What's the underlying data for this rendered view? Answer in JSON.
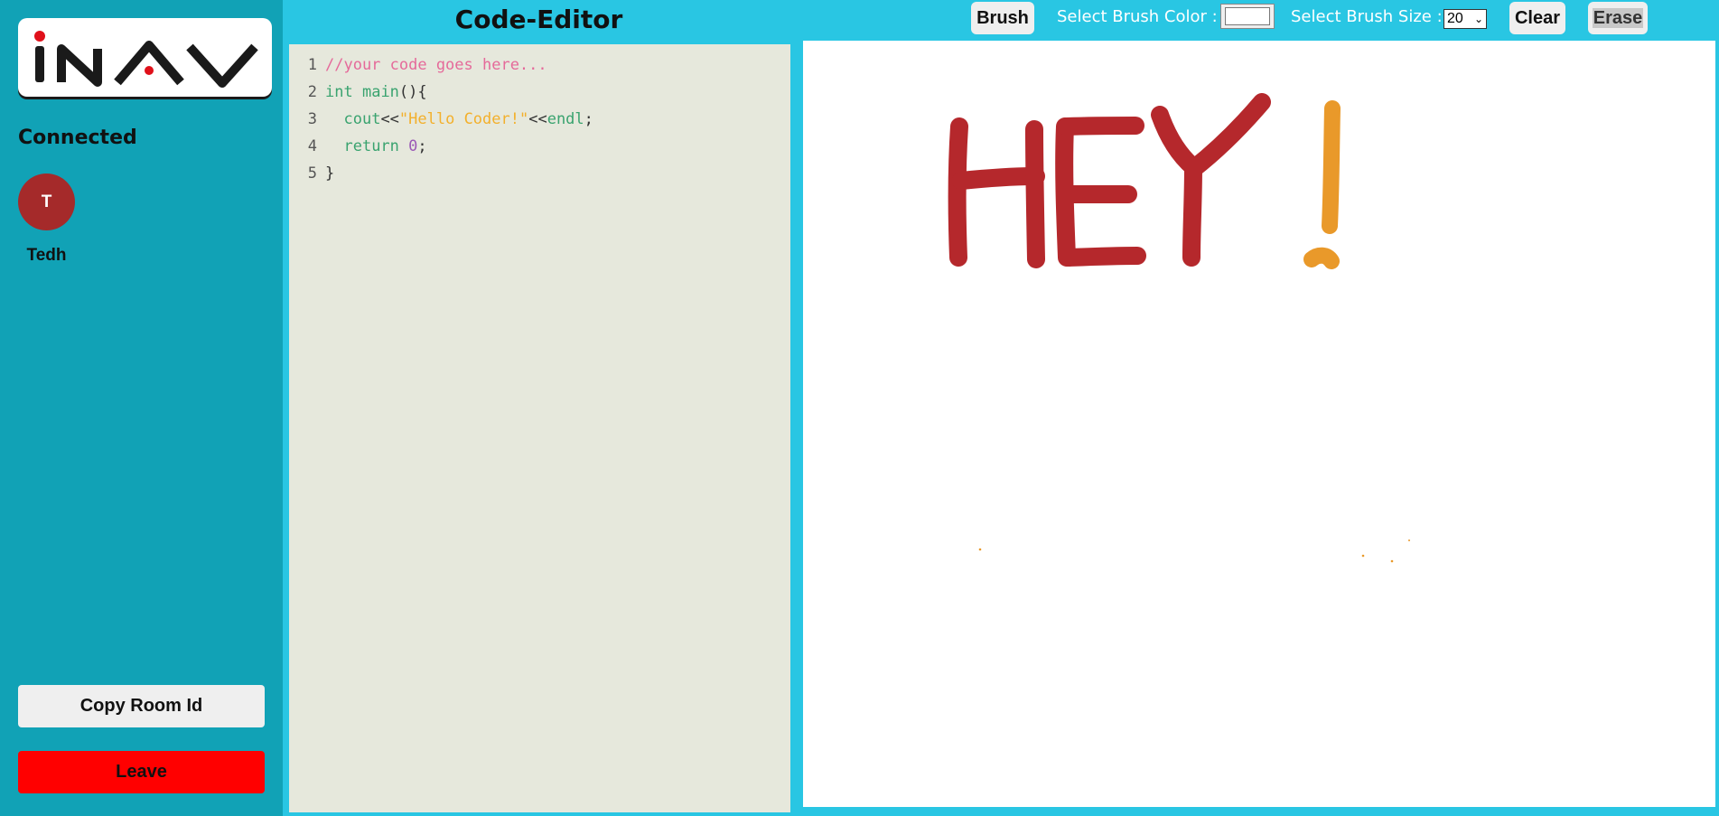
{
  "sidebar": {
    "logo_text": "iNAV",
    "connected_label": "Connected",
    "users": [
      {
        "initial": "T",
        "name": "Tedh",
        "avatar_color": "#a52a2a"
      }
    ],
    "copy_room_label": "Copy Room Id",
    "leave_label": "Leave"
  },
  "editor": {
    "title": "Code-Editor",
    "lines": [
      {
        "num": "1",
        "tokens": [
          {
            "t": "//your code goes here...",
            "c": "comment"
          }
        ]
      },
      {
        "num": "2",
        "tokens": [
          {
            "t": "int",
            "c": "kw"
          },
          {
            "t": " ",
            "c": "plain"
          },
          {
            "t": "main",
            "c": "kw"
          },
          {
            "t": "(){",
            "c": "plain"
          }
        ]
      },
      {
        "num": "3",
        "tokens": [
          {
            "t": "  ",
            "c": "plain"
          },
          {
            "t": "cout",
            "c": "kw"
          },
          {
            "t": "<<",
            "c": "plain"
          },
          {
            "t": "\"Hello Coder!\"",
            "c": "str"
          },
          {
            "t": "<<",
            "c": "plain"
          },
          {
            "t": "endl",
            "c": "kw"
          },
          {
            "t": ";",
            "c": "plain"
          }
        ]
      },
      {
        "num": "4",
        "tokens": [
          {
            "t": "  ",
            "c": "plain"
          },
          {
            "t": "return",
            "c": "kw"
          },
          {
            "t": " ",
            "c": "plain"
          },
          {
            "t": "0",
            "c": "num"
          },
          {
            "t": ";",
            "c": "plain"
          }
        ]
      },
      {
        "num": "5",
        "tokens": [
          {
            "t": "}",
            "c": "plain"
          }
        ]
      }
    ]
  },
  "toolbar": {
    "brush_label": "Brush",
    "color_label": "Select Brush Color :",
    "brush_color": "#ffffff",
    "size_label": "Select Brush Size :",
    "size_value": "20",
    "clear_label": "Clear",
    "erase_label": "Erase"
  },
  "canvas": {
    "stroke_colors": {
      "letters": "#b5282c",
      "exclamation": "#e9992a"
    }
  },
  "colors": {
    "page_bg": "#29c6e3",
    "sidebar_bg": "#11a2b6",
    "editor_bg": "#e6e8dc",
    "leave_bg": "#ff0000"
  }
}
